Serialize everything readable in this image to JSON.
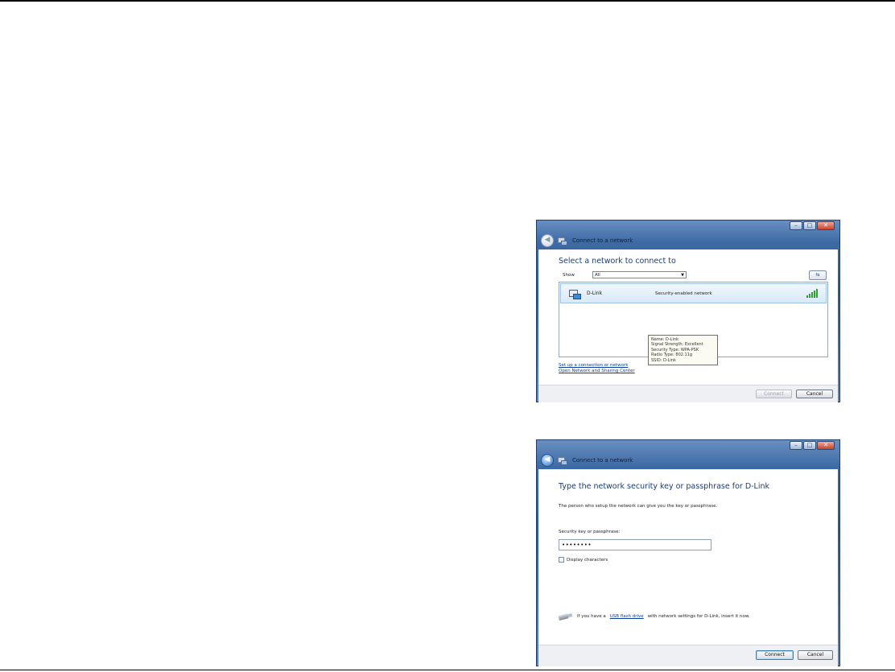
{
  "window1": {
    "title": "Connect to a network",
    "heading": "Select a network to connect to",
    "show_label": "Show",
    "show_value": "All",
    "networks": [
      {
        "name": "D-Link",
        "security": "Security-enabled network",
        "signal_bars": 5
      }
    ],
    "tooltip": [
      "Name: D-Link",
      "Signal Strength: Excellent",
      "Security Type: WPA-PSK",
      "Radio Type: 802.11g",
      "SSID: D-Link"
    ],
    "link_setup": "Set up a connection or network",
    "link_sharing": "Open Network and Sharing Center",
    "connect_label": "Connect",
    "cancel_label": "Cancel"
  },
  "window2": {
    "title": "Connect to a network",
    "heading": "Type the network security key or passphrase for D-Link",
    "description": "The person who setup the network can give you the key or passphrase.",
    "key_label": "Security key or passphrase:",
    "key_value": "••••••••",
    "display_chars_label": "Display characters",
    "usb_prefix": "If you have a",
    "usb_link": "USB flash drive",
    "usb_suffix": "with network settings for D-Link, insert it now.",
    "connect_label": "Connect",
    "cancel_label": "Cancel"
  },
  "colors": {
    "heading": "#1b3c7b",
    "link": "#0b3e9c",
    "signal": "#2ba22b"
  }
}
